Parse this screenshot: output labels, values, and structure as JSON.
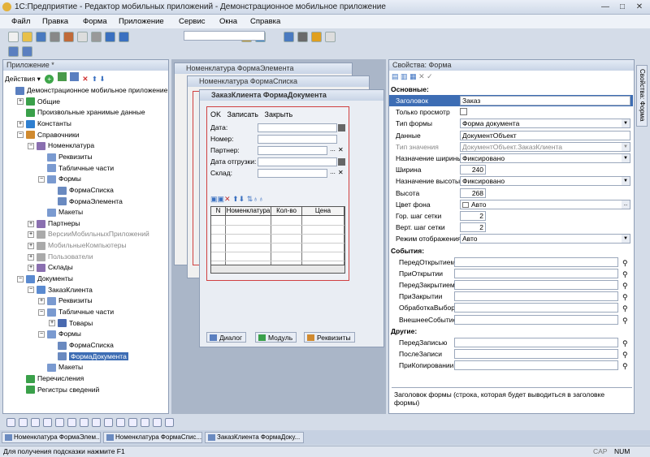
{
  "window": {
    "title": "1С:Предприятие - Редактор мобильных приложений - Демонстрационное мобильное приложение"
  },
  "menu": [
    "Файл",
    "Правка",
    "Форма",
    "Приложение",
    "Сервис",
    "Окна",
    "Справка"
  ],
  "left_panel": {
    "title": "Приложение *",
    "actions_label": "Действия",
    "tree": [
      {
        "label": "Демонстрационное мобильное приложение",
        "level": 0,
        "exp": "",
        "icon": "app-icon",
        "color": "#5a7fc0"
      },
      {
        "label": "Общие",
        "level": 1,
        "exp": "+",
        "icon": "folder-icon",
        "color": "#3aa04a"
      },
      {
        "label": "Произвольные хранимые данные",
        "level": 1,
        "exp": "",
        "icon": "storage-icon",
        "color": "#3aa04a"
      },
      {
        "label": "Константы",
        "level": 1,
        "exp": "+",
        "icon": "constant-icon",
        "color": "#2f7fd0"
      },
      {
        "label": "Справочники",
        "level": 1,
        "exp": "−",
        "icon": "catalog-icon",
        "color": "#d08a2f"
      },
      {
        "label": "Номенклатура",
        "level": 2,
        "exp": "−",
        "icon": "catalog-item-icon",
        "color": "#8a6fb0"
      },
      {
        "label": "Реквизиты",
        "level": 3,
        "exp": "",
        "icon": "attributes-icon",
        "color": "#7a9ad0"
      },
      {
        "label": "Табличные части",
        "level": 3,
        "exp": "",
        "icon": "table-icon",
        "color": "#7a9ad0"
      },
      {
        "label": "Формы",
        "level": 3,
        "exp": "−",
        "icon": "forms-icon",
        "color": "#7a9ad0"
      },
      {
        "label": "ФормаСписка",
        "level": 4,
        "exp": "",
        "icon": "form-icon",
        "color": "#6a8ac0"
      },
      {
        "label": "ФормаЭлемента",
        "level": 4,
        "exp": "",
        "icon": "form-icon",
        "color": "#6a8ac0"
      },
      {
        "label": "Макеты",
        "level": 3,
        "exp": "",
        "icon": "layouts-icon",
        "color": "#7a9ad0"
      },
      {
        "label": "Партнеры",
        "level": 2,
        "exp": "+",
        "icon": "catalog-item-icon",
        "color": "#8a6fb0"
      },
      {
        "label": "ВерсииМобильныхПриложений",
        "level": 2,
        "exp": "+",
        "icon": "catalog-item-icon",
        "color": "#aaa",
        "grey": true
      },
      {
        "label": "МобильныеКомпьютеры",
        "level": 2,
        "exp": "+",
        "icon": "catalog-item-icon",
        "color": "#aaa",
        "grey": true
      },
      {
        "label": "Пользователи",
        "level": 2,
        "exp": "+",
        "icon": "catalog-item-icon",
        "color": "#aaa",
        "grey": true
      },
      {
        "label": "Склады",
        "level": 2,
        "exp": "+",
        "icon": "catalog-item-icon",
        "color": "#8a6fb0"
      },
      {
        "label": "Документы",
        "level": 1,
        "exp": "−",
        "icon": "documents-icon",
        "color": "#5a8ad0"
      },
      {
        "label": "ЗаказКлиента",
        "level": 2,
        "exp": "−",
        "icon": "document-icon",
        "color": "#5a8ad0"
      },
      {
        "label": "Реквизиты",
        "level": 3,
        "exp": "+",
        "icon": "attributes-icon",
        "color": "#7a9ad0"
      },
      {
        "label": "Табличные части",
        "level": 3,
        "exp": "−",
        "icon": "table-icon",
        "color": "#7a9ad0"
      },
      {
        "label": "Товары",
        "level": 4,
        "exp": "+",
        "icon": "table-icon",
        "color": "#4a6ab0"
      },
      {
        "label": "Формы",
        "level": 3,
        "exp": "−",
        "icon": "forms-icon",
        "color": "#7a9ad0"
      },
      {
        "label": "ФормаСписка",
        "level": 4,
        "exp": "",
        "icon": "form-icon",
        "color": "#6a8ac0"
      },
      {
        "label": "ФормаДокумента",
        "level": 4,
        "exp": "",
        "icon": "form-icon",
        "color": "#6a8ac0",
        "selected": true
      },
      {
        "label": "Макеты",
        "level": 3,
        "exp": "",
        "icon": "layouts-icon",
        "color": "#7a9ad0"
      },
      {
        "label": "Перечисления",
        "level": 1,
        "exp": "",
        "icon": "enum-icon",
        "color": "#3aa04a"
      },
      {
        "label": "Регистры сведений",
        "level": 1,
        "exp": "",
        "icon": "register-icon",
        "color": "#3aa04a"
      }
    ]
  },
  "windows": {
    "w1": "Номенклатура ФормаЭлемента",
    "w2": "Номенклатура ФормаСписка",
    "w3": "ЗаказКлиента ФормаДокумента"
  },
  "form": {
    "ok": "OK",
    "write": "Записать",
    "close": "Закрыть",
    "fields": [
      "Дата:",
      "Номер:",
      "Партнер:",
      "Дата отгрузки:",
      "Склад:"
    ],
    "columns": [
      "N",
      "Номенклатура",
      "Кол-во",
      "Цена"
    ],
    "tabs": [
      "Диалог",
      "Модуль",
      "Реквизиты"
    ]
  },
  "properties": {
    "title": "Свойства: Форма",
    "side_tab": "Свойства: Форма",
    "sec_main": "Основные:",
    "sec_events": "События:",
    "sec_other": "Другие:",
    "rows": [
      {
        "label": "Заголовок",
        "value": "Заказ",
        "kind": "text"
      },
      {
        "label": "Только просмотр",
        "value": "",
        "kind": "check"
      },
      {
        "label": "Тип формы",
        "value": "Форма документа",
        "kind": "dd"
      },
      {
        "label": "Данные",
        "value": "ДокументОбъект",
        "kind": "text"
      },
      {
        "label": "Тип значения",
        "value": "ДокументОбъект.ЗаказКлиента",
        "kind": "dd",
        "grey": true
      },
      {
        "label": "Назначение ширины",
        "value": "Фиксировано",
        "kind": "dd"
      },
      {
        "label": "Ширина",
        "value": "240",
        "kind": "num"
      },
      {
        "label": "Назначение высоты",
        "value": "Фиксировано",
        "kind": "dd"
      },
      {
        "label": "Высота",
        "value": "268",
        "kind": "num"
      },
      {
        "label": "Цвет фона",
        "value": "Авто",
        "kind": "color"
      },
      {
        "label": "Гор. шаг сетки",
        "value": "2",
        "kind": "num"
      },
      {
        "label": "Верт. шаг сетки",
        "value": "2",
        "kind": "num"
      },
      {
        "label": "Режим отображения",
        "value": "Авто",
        "kind": "dd"
      }
    ],
    "events": [
      "ПередОткрытием",
      "ПриОткрытии",
      "ПередЗакрытием",
      "ПриЗакрытии",
      "ОбработкаВыбора",
      "ВнешнееСобытие"
    ],
    "other": [
      "ПередЗаписью",
      "ПослеЗаписи",
      "ПриКопировании"
    ],
    "description": "Заголовок формы (строка, которая будет выводиться в заголовке формы)"
  },
  "taskbar": [
    "Номенклатура ФормаЭлем...",
    "Номенклатура ФормаСпис...",
    "ЗаказКлиента ФормаДоку..."
  ],
  "status": {
    "hint": "Для получения подсказки нажмите F1",
    "cap": "CAP",
    "num": "NUM"
  }
}
